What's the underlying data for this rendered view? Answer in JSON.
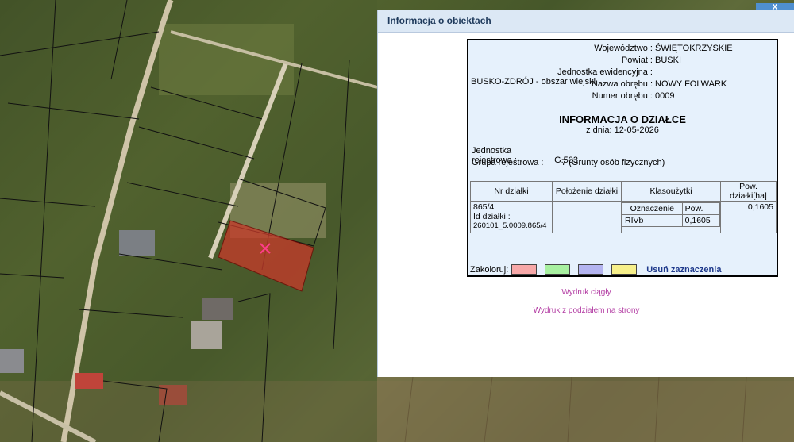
{
  "panel": {
    "title": "Informacja o obiektach",
    "close_label": "X"
  },
  "info": {
    "rows": [
      {
        "label": "Województwo :",
        "value": "ŚWIĘTOKRZYSKIE"
      },
      {
        "label": "Powiat :",
        "value": "BUSKI"
      },
      {
        "label": "Jednostka ewidencyjna :",
        "value": "BUSKO-ZDRÓJ - obszar wiejski"
      },
      {
        "label": "Nazwa obrębu :",
        "value": "NOWY FOLWARK"
      },
      {
        "label": "Numer obrębu :",
        "value": "0009"
      }
    ],
    "title": "INFORMACJA O DZIAŁCE",
    "date": "z dnia: 12-05-2026",
    "reg_unit_label": "Jednostka rejestrowa :",
    "reg_unit_value": "G.503",
    "reg_group_label": "Grupa rejestrowa :",
    "reg_group_value": "7 (Grunty osób fizycznych)"
  },
  "table": {
    "headers": [
      "Nr działki",
      "Położenie działki",
      "Klasoużytki",
      "Pow. działki[ha]"
    ],
    "parcel_nr": "865/4",
    "id_label": "Id działki :",
    "id_value": "260101_5.0009.865/4",
    "sub_headers": [
      "Oznaczenie",
      "Pow."
    ],
    "class_code": "RIVb",
    "class_area": "0,1605",
    "area": "0,1605"
  },
  "colorize": {
    "label": "Zakoloruj:",
    "colors": [
      "#f7a8a8",
      "#a8f0a0",
      "#b4b4f0",
      "#f7f08a"
    ],
    "clear_label": "Usuń zaznaczenia"
  },
  "print": {
    "continuous": "Wydruk ciągły",
    "paged": "Wydruk z podziałem na strony"
  }
}
